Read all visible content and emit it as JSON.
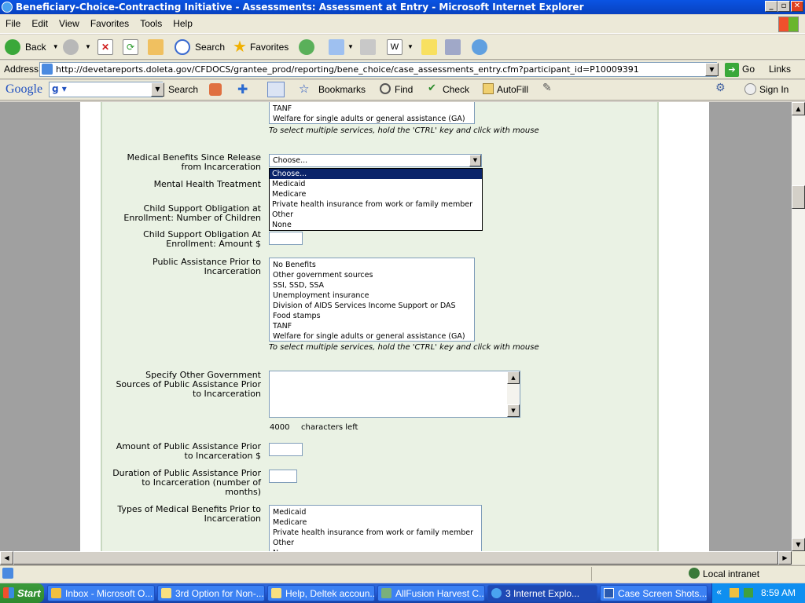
{
  "window": {
    "title": "Beneficiary-Choice-Contracting Initiative - Assessments: Assessment at Entry - Microsoft Internet Explorer",
    "minimize": "_",
    "maximize": "▫",
    "close": "✕"
  },
  "menu": [
    "File",
    "Edit",
    "View",
    "Favorites",
    "Tools",
    "Help"
  ],
  "toolbar": {
    "back": "Back",
    "search": "Search",
    "favorites": "Favorites"
  },
  "address": {
    "label": "Address",
    "url": "http://devetareports.doleta.gov/CFDOCS/grantee_prod/reporting/bene_choice/case_assessments_entry.cfm?participant_id=P10009391",
    "go": "Go",
    "links": "Links"
  },
  "google": {
    "logo": "Google",
    "search": "Search",
    "bookmarks": "Bookmarks",
    "find": "Find",
    "check": "Check",
    "autofill": "AutoFill",
    "signin": "Sign In"
  },
  "form": {
    "top_list_items": [
      "TANF",
      "Welfare for single adults or general assistance (GA)"
    ],
    "multi_hint": "To select multiple services, hold the 'CTRL' key and click with mouse",
    "medical_since_release": {
      "label1": "Medical Benefits Since Release",
      "label2": "from Incarceration",
      "selected": "Choose...",
      "options": [
        "Choose...",
        "Medicaid",
        "Medicare",
        "Private health insurance from work or family member",
        "Other",
        "None"
      ]
    },
    "mental_health": {
      "label": "Mental Health Treatment"
    },
    "child_support_num": {
      "label1": "Child Support Obligation at",
      "label2": "Enrollment:  Number of Children"
    },
    "child_support_amt": {
      "label1": "Child Support Obligation At",
      "label2": "Enrollment:  Amount $"
    },
    "public_assistance_prior": {
      "label1": "Public Assistance Prior to",
      "label2": "Incarceration",
      "items": [
        "No Benefits",
        "Other government sources",
        "SSI, SSD, SSA",
        "Unemployment insurance",
        "Division of AIDS Services Income Support or DAS",
        "Food stamps",
        "TANF",
        "Welfare for single adults or general assistance (GA)"
      ]
    },
    "other_gov_sources": {
      "label1": "Specify Other Government",
      "label2": "Sources of Public Assistance Prior",
      "label3": "to Incarceration",
      "chars_value": "4000",
      "chars_label": "characters left"
    },
    "amount_pa": {
      "label1": "Amount of Public Assistance Prior",
      "label2": "to Incarceration $"
    },
    "duration_pa": {
      "label1": "Duration of Public Assistance Prior",
      "label2": "to Incarceration (number of",
      "label3": "months)"
    },
    "types_medical": {
      "label1": "Types of Medical Benefits Prior to",
      "label2": "Incarceration",
      "items": [
        "Medicaid",
        "Medicare",
        "Private health insurance from work or family member",
        "Other",
        "N"
      ]
    }
  },
  "status": {
    "zone": "Local intranet"
  },
  "taskbar": {
    "start": "Start",
    "tasks": [
      "Inbox - Microsoft O...",
      "3rd Option for Non-...",
      "Help, Deltek accoun...",
      "AllFusion Harvest C...",
      "3 Internet Explo...",
      "Case Screen Shots...."
    ],
    "clock": "8:59 AM",
    "chevron": "«"
  }
}
